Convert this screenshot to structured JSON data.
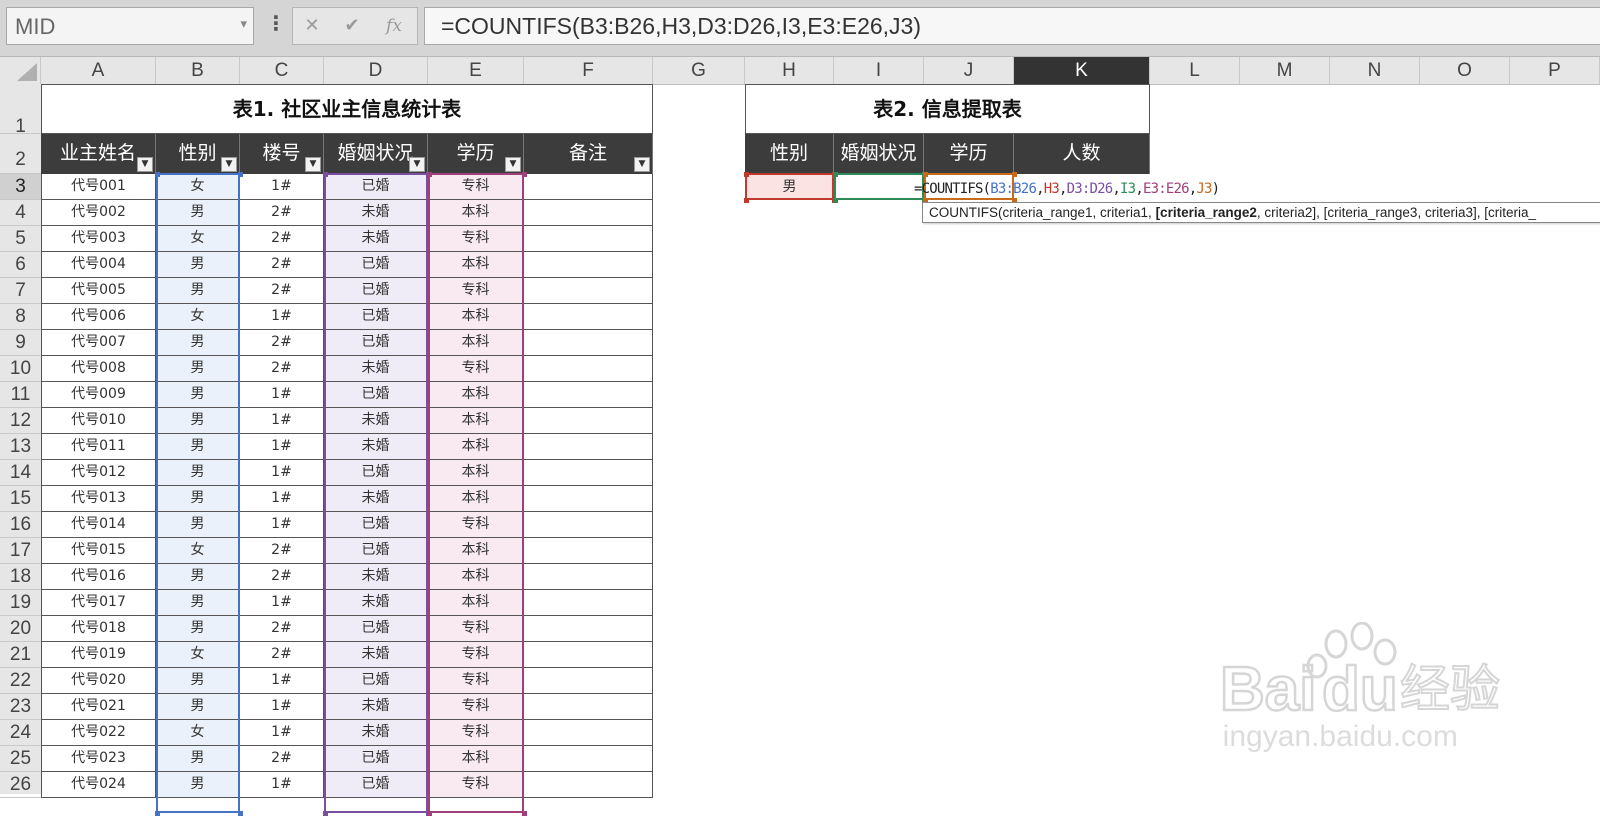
{
  "formula_bar": {
    "name_box": "MID",
    "menu_dots_icon": "vertical-dots-icon",
    "cancel_icon": "cancel-x-icon",
    "enter_icon": "check-icon",
    "function_icon": "fx-icon",
    "cancel_glyph": "✕",
    "enter_glyph": "✔",
    "function_glyph": "fx",
    "formula": "=COUNTIFS(B3:B26,H3,D3:D26,I3,E3:E26,J3)"
  },
  "columns": [
    "A",
    "B",
    "C",
    "D",
    "E",
    "F",
    "G",
    "H",
    "I",
    "J",
    "K",
    "L",
    "M",
    "N",
    "O",
    "P"
  ],
  "selected_column": "K",
  "rows": [
    "1",
    "2",
    "3",
    "4",
    "5",
    "6",
    "7",
    "8",
    "9",
    "10",
    "11",
    "12",
    "13",
    "14",
    "15",
    "16",
    "17",
    "18",
    "19",
    "20",
    "21",
    "22",
    "23",
    "24",
    "25",
    "26"
  ],
  "selected_row": "3",
  "table1": {
    "title": "表1. 社区业主信息统计表",
    "headers": [
      "业主姓名",
      "性别",
      "楼号",
      "婚姻状况",
      "学历",
      "备注"
    ],
    "data": [
      [
        "代号001",
        "女",
        "1#",
        "已婚",
        "专科",
        ""
      ],
      [
        "代号002",
        "男",
        "2#",
        "未婚",
        "本科",
        ""
      ],
      [
        "代号003",
        "女",
        "2#",
        "未婚",
        "专科",
        ""
      ],
      [
        "代号004",
        "男",
        "2#",
        "已婚",
        "本科",
        ""
      ],
      [
        "代号005",
        "男",
        "2#",
        "已婚",
        "专科",
        ""
      ],
      [
        "代号006",
        "女",
        "1#",
        "已婚",
        "本科",
        ""
      ],
      [
        "代号007",
        "男",
        "2#",
        "已婚",
        "本科",
        ""
      ],
      [
        "代号008",
        "男",
        "2#",
        "未婚",
        "专科",
        ""
      ],
      [
        "代号009",
        "男",
        "1#",
        "已婚",
        "本科",
        ""
      ],
      [
        "代号010",
        "男",
        "1#",
        "未婚",
        "本科",
        ""
      ],
      [
        "代号011",
        "男",
        "1#",
        "未婚",
        "本科",
        ""
      ],
      [
        "代号012",
        "男",
        "1#",
        "已婚",
        "本科",
        ""
      ],
      [
        "代号013",
        "男",
        "1#",
        "未婚",
        "本科",
        ""
      ],
      [
        "代号014",
        "男",
        "1#",
        "已婚",
        "专科",
        ""
      ],
      [
        "代号015",
        "女",
        "2#",
        "已婚",
        "本科",
        ""
      ],
      [
        "代号016",
        "男",
        "2#",
        "未婚",
        "本科",
        ""
      ],
      [
        "代号017",
        "男",
        "1#",
        "未婚",
        "本科",
        ""
      ],
      [
        "代号018",
        "男",
        "2#",
        "已婚",
        "专科",
        ""
      ],
      [
        "代号019",
        "女",
        "2#",
        "未婚",
        "专科",
        ""
      ],
      [
        "代号020",
        "男",
        "1#",
        "已婚",
        "专科",
        ""
      ],
      [
        "代号021",
        "男",
        "1#",
        "未婚",
        "专科",
        ""
      ],
      [
        "代号022",
        "女",
        "1#",
        "未婚",
        "专科",
        ""
      ],
      [
        "代号023",
        "男",
        "2#",
        "已婚",
        "本科",
        ""
      ],
      [
        "代号024",
        "男",
        "1#",
        "已婚",
        "专科",
        ""
      ]
    ]
  },
  "table2": {
    "title": "表2. 信息提取表",
    "headers": [
      "性别",
      "婚姻状况",
      "学历",
      "人数"
    ],
    "row": {
      "gender": "男",
      "marital": "",
      "education": "",
      "count": ""
    }
  },
  "cell_edit": {
    "parts": [
      {
        "text": "=COUNTIFS(",
        "color": "#222222"
      },
      {
        "text": "B3:B26",
        "color": "#4472c4"
      },
      {
        "text": ",",
        "color": "#222222"
      },
      {
        "text": "H3",
        "color": "#c0392b"
      },
      {
        "text": ",",
        "color": "#222222"
      },
      {
        "text": "D3:D26",
        "color": "#7b4fa0"
      },
      {
        "text": ",",
        "color": "#222222"
      },
      {
        "text": "I3",
        "color": "#2e8b57"
      },
      {
        "text": ",",
        "color": "#222222"
      },
      {
        "text": "E3:E26",
        "color": "#a0407a"
      },
      {
        "text": ",",
        "color": "#222222"
      },
      {
        "text": "J3",
        "color": "#c96a1b"
      },
      {
        "text": ")",
        "color": "#222222"
      }
    ]
  },
  "tooltip": {
    "pre": "COUNTIFS(criteria_range1, criteria1, ",
    "current": "[criteria_range2",
    "post": ", criteria2], [criteria_range3, criteria3], [criteria_"
  },
  "colors": {
    "header_dark": "#3c3c3c",
    "gender_fill": "#ebf1fa",
    "marital_fill": "#f0ecf7",
    "education_fill": "#f8eaf0",
    "h3_fill": "#fbe3e3",
    "range_b": "#4472c4",
    "range_h": "#c0392b",
    "range_d": "#7b4fa0",
    "range_i": "#2e8b57",
    "range_e": "#a0407a",
    "range_j": "#c96a1b"
  },
  "watermark": {
    "brand": "Bai",
    "brand2": "du",
    "cn": "经验",
    "url": "jingyan.baidu.com"
  }
}
